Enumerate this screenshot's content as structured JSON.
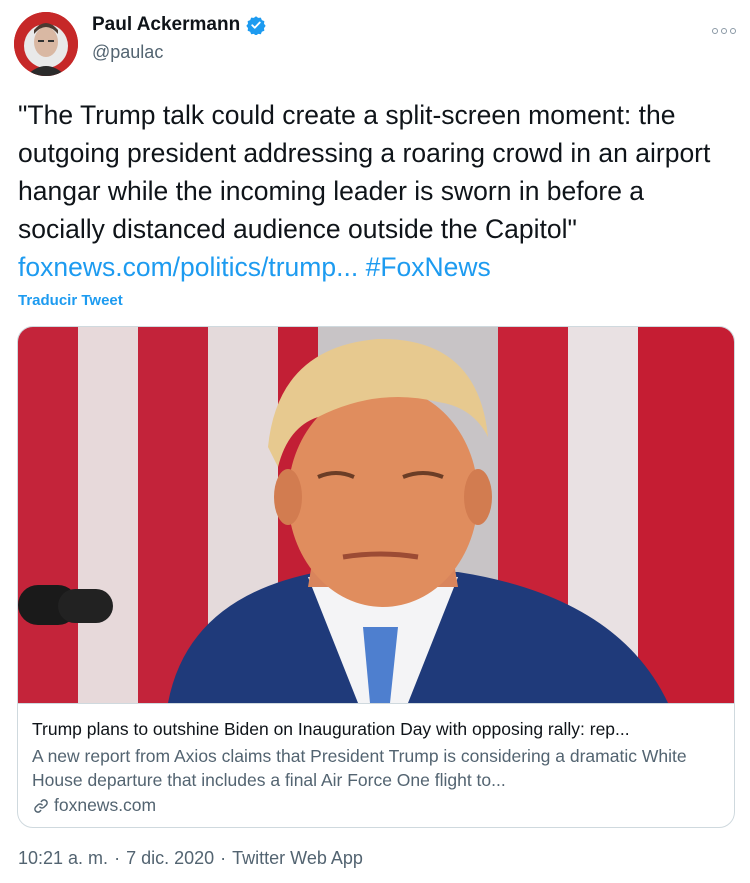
{
  "author": {
    "name": "Paul Ackermann",
    "handle": "@paulac",
    "verified": true
  },
  "tweet": {
    "text_plain": "\"The Trump talk could create a split-screen moment: the outgoing president addressing a roaring crowd in an airport hangar while the incoming leader is sworn in before a socially distanced audience outside the Capitol\"",
    "link": "foxnews.com/politics/trump...",
    "hashtag": "#FoxNews",
    "translate_label": "Traducir Tweet"
  },
  "card": {
    "title": "Trump plans to outshine Biden on Inauguration Day with opposing rally: rep...",
    "description": "A new report from Axios claims that President Trump is considering a dramatic White House departure that includes a final Air Force One flight to...",
    "domain": "foxnews.com"
  },
  "meta": {
    "time": "10:21 a. m.",
    "separator1": "·",
    "date": "7 dic. 2020",
    "separator2": "·",
    "source": "Twitter Web App"
  },
  "colors": {
    "link": "#1d9bf0",
    "secondary": "#536471",
    "verified": "#1d9bf0",
    "border": "#cfd9de"
  },
  "icons": {
    "verified": "verified-badge-icon",
    "more": "more-options-icon",
    "link": "link-icon"
  }
}
